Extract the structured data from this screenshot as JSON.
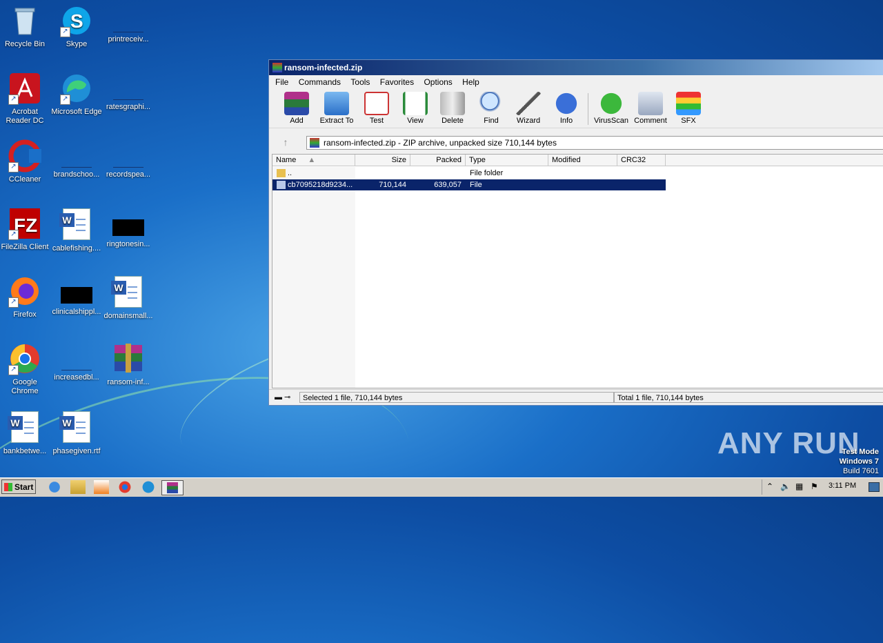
{
  "desktop": {
    "icons": [
      {
        "label": "Recycle Bin"
      },
      {
        "label": "Skype"
      },
      {
        "label": "printreceiv..."
      },
      {
        "label": "Acrobat Reader DC"
      },
      {
        "label": "Microsoft Edge"
      },
      {
        "label": "ratesgraphi..."
      },
      {
        "label": "CCleaner"
      },
      {
        "label": "brandschoo..."
      },
      {
        "label": "recordspea..."
      },
      {
        "label": "FileZilla Client"
      },
      {
        "label": "cablefishing...."
      },
      {
        "label": "ringtonesin..."
      },
      {
        "label": "Firefox"
      },
      {
        "label": "clinicalshippl..."
      },
      {
        "label": "domainsmall..."
      },
      {
        "label": "Google Chrome"
      },
      {
        "label": "increasedbl..."
      },
      {
        "label": "ransom-inf..."
      },
      {
        "label": "bankbetwe..."
      },
      {
        "label": "phasegiven.rtf"
      }
    ]
  },
  "window": {
    "title": "ransom-infected.zip",
    "menu": [
      "File",
      "Commands",
      "Tools",
      "Favorites",
      "Options",
      "Help"
    ],
    "toolbar": [
      "Add",
      "Extract To",
      "Test",
      "View",
      "Delete",
      "Find",
      "Wizard",
      "Info",
      "VirusScan",
      "Comment",
      "SFX"
    ],
    "address": "ransom-infected.zip - ZIP archive, unpacked size 710,144 bytes",
    "columns": [
      "Name",
      "Size",
      "Packed",
      "Type",
      "Modified",
      "CRC32"
    ],
    "rows": [
      {
        "name": "..",
        "size": "",
        "packed": "",
        "type": "File folder"
      },
      {
        "name": "cb7095218d9234...",
        "size": "710,144",
        "packed": "639,057",
        "type": "File"
      }
    ],
    "status_left": "Selected 1 file, 710,144 bytes",
    "status_right": "Total 1 file, 710,144 bytes"
  },
  "taskbar": {
    "start": "Start",
    "clock": "3:11 PM"
  },
  "watermark": "ANY RUN",
  "testmode": {
    "line1": "Test Mode",
    "line2": "Windows 7",
    "line3": "Build 7601"
  },
  "colors": {
    "selection": "#0a246a",
    "titlebar": "#0a246a"
  }
}
